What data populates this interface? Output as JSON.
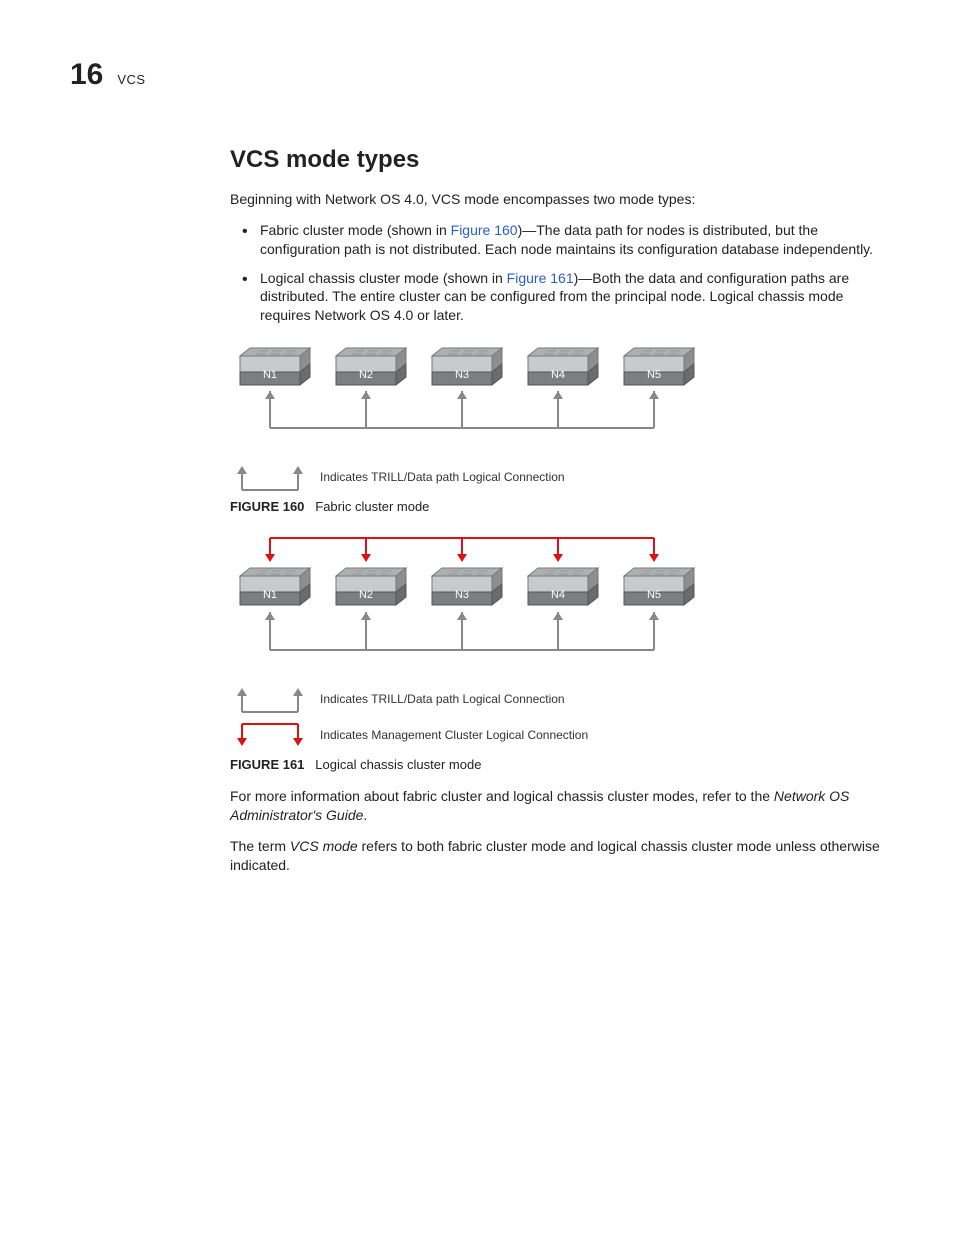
{
  "header": {
    "chapter_number": "16",
    "chapter_title": "VCS"
  },
  "section": {
    "title": "VCS mode types",
    "intro": "Beginning with Network OS 4.0, VCS mode encompasses two mode types:"
  },
  "bullets": [
    {
      "lead": "Fabric cluster mode (shown in ",
      "xref": "Figure 160",
      "tail": ")—The data path for nodes is distributed, but the configuration path is not distributed.  Each node maintains its configuration database independently."
    },
    {
      "lead": "Logical chassis cluster mode (shown in ",
      "xref": "Figure 161",
      "tail": ")—Both the data and configuration paths are distributed. The entire cluster can be configured from the principal node. Logical chassis mode requires Network OS 4.0 or later."
    }
  ],
  "figure160": {
    "label": "FIGURE 160",
    "caption": "Fabric cluster mode",
    "nodes": [
      "N1",
      "N2",
      "N3",
      "N4",
      "N5"
    ],
    "legend_trill": "Indicates TRILL/Data path Logical Connection"
  },
  "figure161": {
    "label": "FIGURE 161",
    "caption": "Logical chassis cluster mode",
    "nodes": [
      "N1",
      "N2",
      "N3",
      "N4",
      "N5"
    ],
    "legend_trill": "Indicates TRILL/Data path Logical Connection",
    "legend_mgmt": "Indicates Management Cluster Logical Connection"
  },
  "closing": {
    "p1a": "For more information about fabric cluster and logical chassis cluster modes, refer to the ",
    "p1b_italic": "Network OS Administrator's Guide",
    "p1c": ".",
    "p2a": "The term ",
    "p2b_italic": "VCS mode",
    "p2c": " refers to both fabric cluster mode and logical chassis cluster mode unless otherwise indicated."
  }
}
